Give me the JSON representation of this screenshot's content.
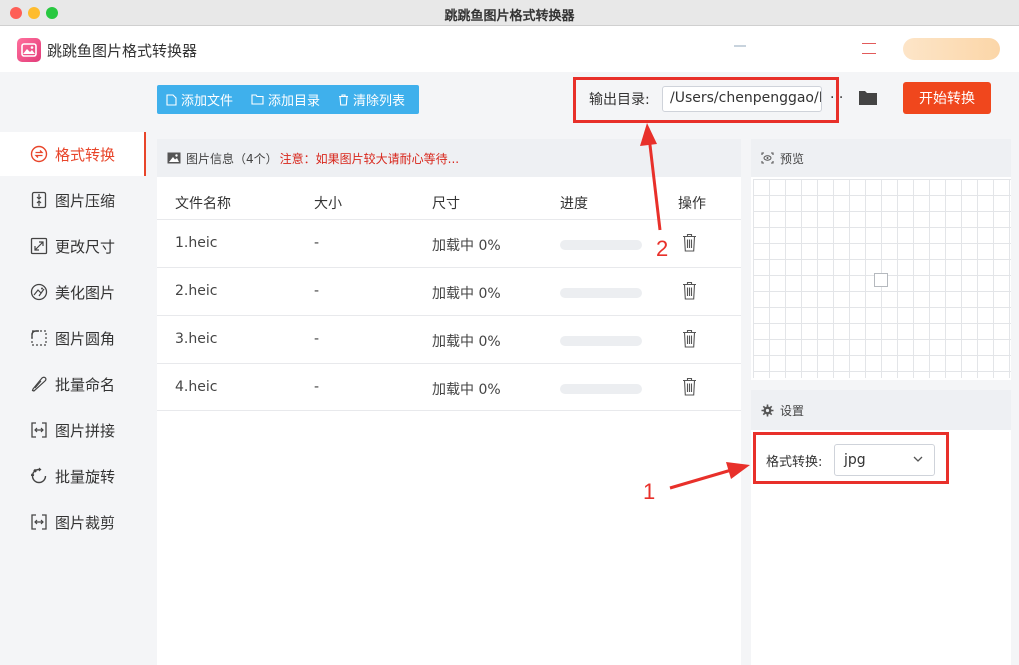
{
  "window": {
    "title": "跳跳鱼图片格式转换器"
  },
  "app": {
    "title": "跳跳鱼图片格式转换器"
  },
  "sidebar": {
    "items": [
      {
        "label": "格式转换",
        "icon": "format-convert-icon",
        "active": true
      },
      {
        "label": "图片压缩",
        "icon": "compress-icon"
      },
      {
        "label": "更改尺寸",
        "icon": "resize-icon"
      },
      {
        "label": "美化图片",
        "icon": "beautify-icon"
      },
      {
        "label": "图片圆角",
        "icon": "round-corner-icon"
      },
      {
        "label": "批量命名",
        "icon": "rename-icon"
      },
      {
        "label": "图片拼接",
        "icon": "stitch-icon"
      },
      {
        "label": "批量旋转",
        "icon": "rotate-icon"
      },
      {
        "label": "图片裁剪",
        "icon": "crop-icon"
      }
    ]
  },
  "toolbar": {
    "add_file": "添加文件",
    "add_dir": "添加目录",
    "clear_list": "清除列表",
    "output_label": "输出目录:",
    "output_path": "/Users/chenpenggao/D",
    "more": "···",
    "start": "开始转换"
  },
  "filelist": {
    "header_title": "图片信息（4个）",
    "header_note": "注意：如果图片较大请耐心等待...",
    "columns": [
      "文件名称",
      "大小",
      "尺寸",
      "进度",
      "操作"
    ],
    "rows": [
      {
        "name": "1.heic",
        "size": "-",
        "dim": "加载中 0%",
        "progress": 0
      },
      {
        "name": "2.heic",
        "size": "-",
        "dim": "加载中 0%",
        "progress": 0
      },
      {
        "name": "3.heic",
        "size": "-",
        "dim": "加载中 0%",
        "progress": 0
      },
      {
        "name": "4.heic",
        "size": "-",
        "dim": "加载中 0%",
        "progress": 0
      }
    ]
  },
  "preview": {
    "title": "预览"
  },
  "settings": {
    "title": "设置",
    "format_label": "格式转换:",
    "format_value": "jpg"
  },
  "annotations": {
    "one": "1",
    "two": "2"
  },
  "colors": {
    "accent": "#e8452a",
    "primary_blue": "#3fb0ec",
    "start_button": "#f0471d",
    "annotation_red": "#e8302a"
  }
}
